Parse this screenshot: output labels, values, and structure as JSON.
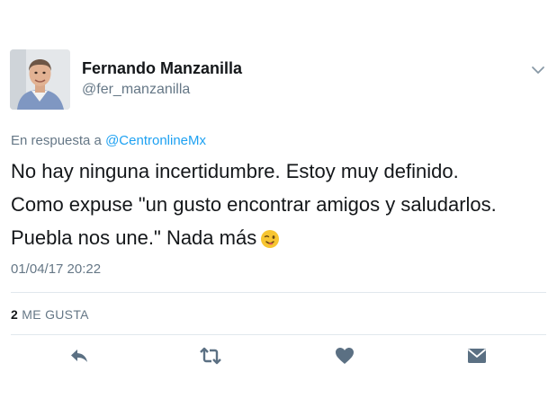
{
  "author": {
    "name": "Fernando Manzanilla",
    "handle": "@fer_manzanilla"
  },
  "reply_to": {
    "prefix": "En respuesta a",
    "mention": "@CentronlineMx"
  },
  "tweet": {
    "line1": "No hay ninguna incertidumbre. Estoy muy definido.",
    "line2": "Como expuse \"un gusto encontrar amigos y saludarlos.",
    "line3": "Puebla nos une.\" Nada más",
    "emoji": "winking-face-emoji"
  },
  "timestamp": "01/04/17 20:22",
  "likes": {
    "count": "2",
    "label": "ME GUSTA"
  },
  "actions": [
    {
      "icon": "reply-icon"
    },
    {
      "icon": "retweet-icon"
    },
    {
      "icon": "heart-icon"
    },
    {
      "icon": "direct-message-icon"
    }
  ],
  "colors": {
    "text": "#14171a",
    "secondary": "#657786",
    "link": "#1da1f2",
    "icon": "#5b7083",
    "divider": "#e1e8ed"
  }
}
